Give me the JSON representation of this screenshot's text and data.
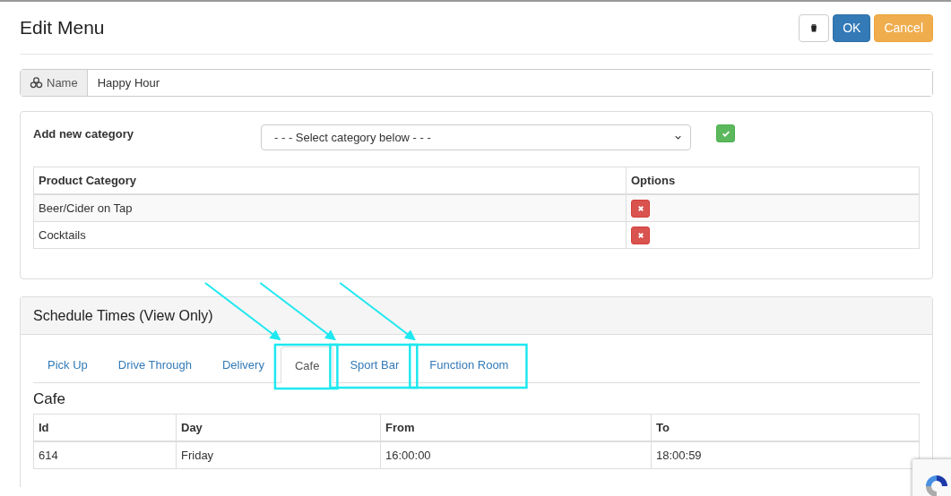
{
  "page": {
    "title": "Edit Menu"
  },
  "header_buttons": [
    {
      "kind": "delete"
    },
    {
      "kind": "ok",
      "label": "OK"
    },
    {
      "kind": "cancel",
      "label": "Cancel"
    }
  ],
  "name_field": {
    "label": "Name",
    "value": "Happy Hour"
  },
  "categories_panel": {
    "add_label": "Add new category",
    "select": {
      "value": "- - - Select category below - - -"
    },
    "table": {
      "columns": [
        "Product Category",
        "Options"
      ],
      "rows": [
        {
          "name": "Beer/Cider on Tap"
        },
        {
          "name": "Cocktails"
        }
      ]
    }
  },
  "schedule_panel": {
    "title": "Schedule Times (View Only)",
    "tabs": [
      {
        "label": "Pick Up",
        "selected": false,
        "highlighted": false
      },
      {
        "label": "Drive Through",
        "selected": false,
        "highlighted": false
      },
      {
        "label": "Delivery",
        "selected": false,
        "highlighted": false
      },
      {
        "label": "Cafe",
        "selected": true,
        "highlighted": true
      },
      {
        "label": "Sport Bar",
        "selected": false,
        "highlighted": true
      },
      {
        "label": "Function Room",
        "selected": false,
        "highlighted": true
      }
    ],
    "section_title": "Cafe",
    "table": {
      "columns": [
        "Id",
        "Day",
        "From",
        "To"
      ],
      "rows": [
        [
          "614",
          "Friday",
          "16:00:00",
          "18:00:59"
        ]
      ]
    }
  }
}
